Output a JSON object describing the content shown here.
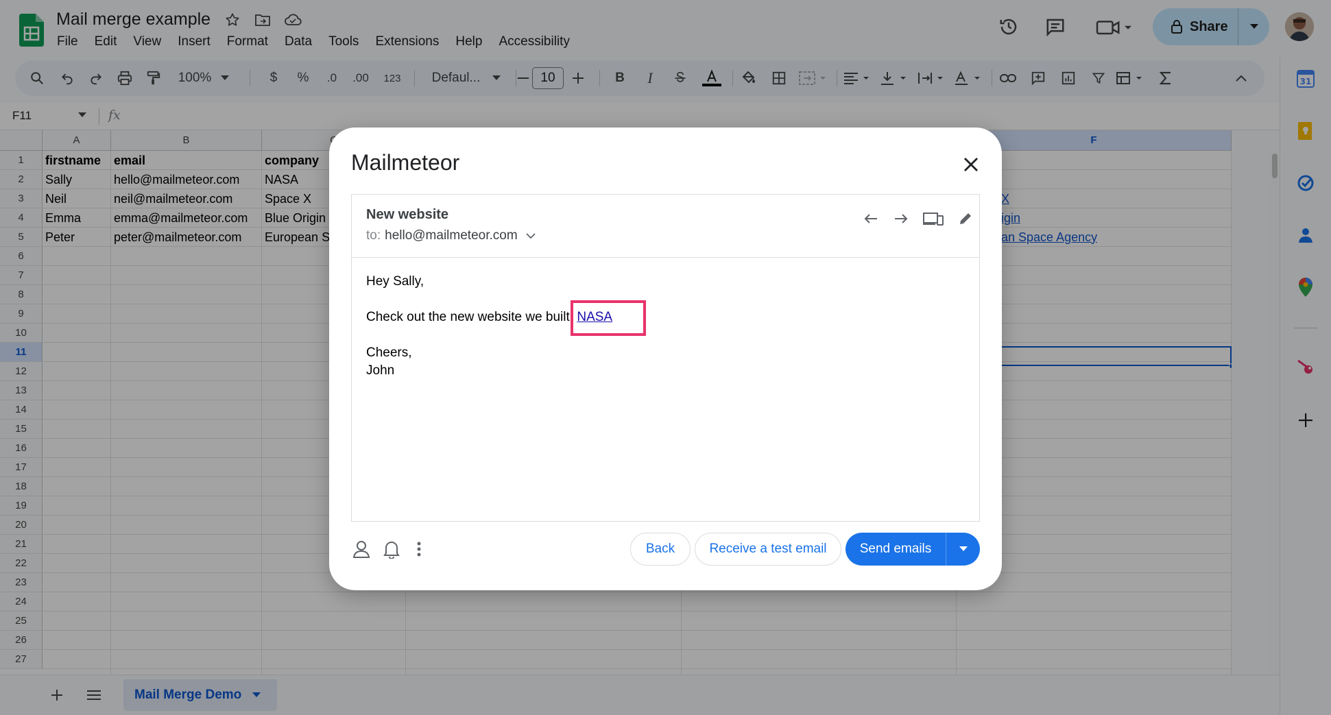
{
  "document": {
    "title": "Mail merge example"
  },
  "menu": [
    "File",
    "Edit",
    "View",
    "Insert",
    "Format",
    "Data",
    "Tools",
    "Extensions",
    "Help",
    "Accessibility"
  ],
  "share": {
    "label": "Share"
  },
  "toolbar": {
    "zoom": "100%",
    "currency": "$",
    "percent": "%",
    "dec_less": ".0",
    "dec_more": ".00",
    "number_format": "123",
    "font": "Defaul...",
    "font_size": "10",
    "bold": "B",
    "italic": "I"
  },
  "formula_bar": {
    "cell_ref": "F11",
    "fx": "fx"
  },
  "grid": {
    "columns": [
      "A",
      "B",
      "C",
      "F"
    ],
    "rows": [
      "1",
      "2",
      "3",
      "4",
      "5",
      "6",
      "7",
      "8",
      "9",
      "10",
      "11",
      "12",
      "13",
      "14",
      "15",
      "16",
      "17",
      "18",
      "19",
      "20",
      "21",
      "22",
      "23",
      "24",
      "25",
      "26",
      "27"
    ],
    "headers": [
      "firstname",
      "email",
      "company"
    ],
    "data": [
      [
        "Sally",
        "hello@mailmeteor.com",
        "NASA"
      ],
      [
        "Neil",
        "neil@mailmeteor.com",
        "Space X"
      ],
      [
        "Emma",
        "emma@mailmeteor.com",
        "Blue Origin"
      ],
      [
        "Peter",
        "peter@mailmeteor.com",
        "European S"
      ]
    ],
    "col_f_links": [
      "X",
      "igin",
      "an Space Agency"
    ]
  },
  "sheet_tab": {
    "label": "Mail Merge Demo"
  },
  "dialog": {
    "title": "Mailmeteor",
    "preview": {
      "subject": "New website",
      "to_label": "to:",
      "to_value": "hello@mailmeteor.com",
      "greeting": "Hey Sally,",
      "line_text": "Check out the new website we built: ",
      "link_text": "NASA",
      "closing": "Cheers,",
      "signature": "John"
    },
    "buttons": {
      "back": "Back",
      "test": "Receive a test email",
      "send": "Send emails"
    }
  },
  "colors": {
    "accent": "#1a73e8",
    "highlight": "#e8336b",
    "share_bg": "#c2e7ff",
    "link": "#1155cc"
  }
}
